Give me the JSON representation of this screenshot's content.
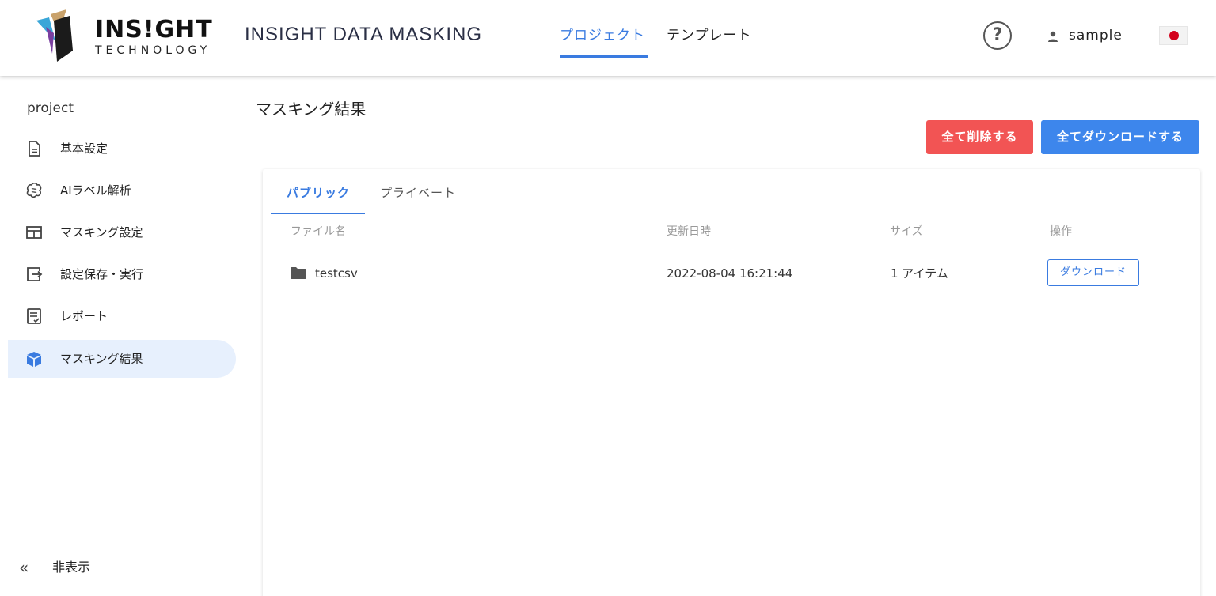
{
  "header": {
    "logo_word": "INS!GHT",
    "logo_sub": "TECHNOLOGY",
    "app_title": "INSIGHT DATA MASKING",
    "nav": [
      {
        "label": "プロジェクト",
        "active": true
      },
      {
        "label": "テンプレート",
        "active": false
      }
    ],
    "help_glyph": "?",
    "user_name": "sample",
    "locale_flag": "jp-flag-icon"
  },
  "sidebar": {
    "project_label": "project",
    "items": [
      {
        "label": "基本設定",
        "icon": "document-icon"
      },
      {
        "label": "AIラベル解析",
        "icon": "brain-icon"
      },
      {
        "label": "マスキング設定",
        "icon": "table-grid-icon"
      },
      {
        "label": "設定保存・実行",
        "icon": "export-icon"
      },
      {
        "label": "レポート",
        "icon": "report-icon"
      },
      {
        "label": "マスキング結果",
        "icon": "cube-icon",
        "active": true
      }
    ],
    "hide_label": "非表示",
    "hide_glyph": "«"
  },
  "main": {
    "title": "マスキング結果",
    "delete_all_label": "全て削除する",
    "download_all_label": "全てダウンロードする",
    "tabs": [
      {
        "label": "パブリック",
        "active": true
      },
      {
        "label": "プライベート",
        "active": false
      }
    ],
    "columns": [
      "ファイル名",
      "更新日時",
      "サイズ",
      "操作"
    ],
    "rows": [
      {
        "name": "testcsv",
        "icon": "folder-icon",
        "updated": "2022-08-04 16:21:44",
        "size": "1 アイテム",
        "action": "ダウンロード"
      }
    ]
  },
  "colors": {
    "accent": "#3a7be0",
    "danger": "#f25454",
    "primary_button": "#3d86ec",
    "active_nav_bg": "#e7f0fd"
  }
}
